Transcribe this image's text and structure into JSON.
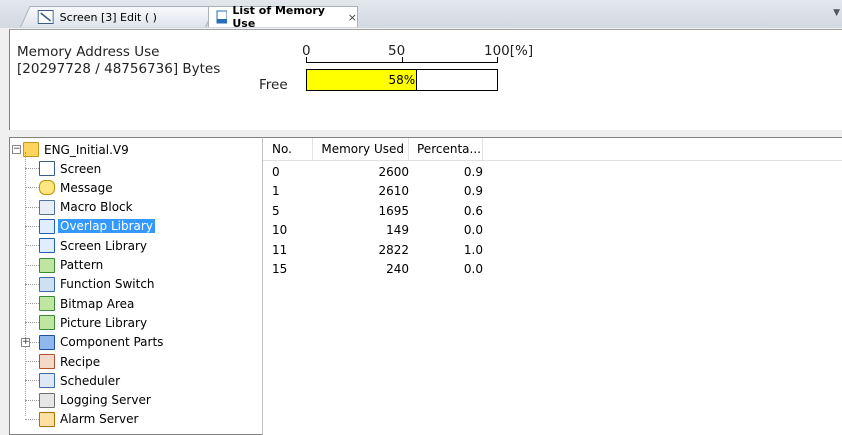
{
  "tabs": [
    {
      "label": "Screen [3] Edit (          )"
    },
    {
      "label": "List of Memory Use",
      "close": "×"
    }
  ],
  "memory": {
    "title": "Memory Address Use",
    "bytes": "[20297728 / 48756736] Bytes",
    "free_label": "Free",
    "scale": {
      "zero": "0",
      "mid": "50",
      "max": "100[%]"
    },
    "bar_percent_text": "58%",
    "bar_fill_fraction": 0.58,
    "bar_color": "#ffff00"
  },
  "tree": {
    "root": "ENG_Initial.V9",
    "items": [
      {
        "label": "Screen",
        "icon": "screen-icon"
      },
      {
        "label": "Message",
        "icon": "message-icon"
      },
      {
        "label": "Macro Block",
        "icon": "macro-block-icon"
      },
      {
        "label": "Overlap Library",
        "icon": "overlap-library-icon",
        "selected": true
      },
      {
        "label": "Screen Library",
        "icon": "screen-library-icon"
      },
      {
        "label": "Pattern",
        "icon": "pattern-icon"
      },
      {
        "label": "Function Switch",
        "icon": "function-switch-icon"
      },
      {
        "label": "Bitmap Area",
        "icon": "bitmap-area-icon"
      },
      {
        "label": "Picture Library",
        "icon": "picture-library-icon"
      },
      {
        "label": "Component Parts",
        "icon": "component-parts-icon",
        "expandable": true
      },
      {
        "label": "Recipe",
        "icon": "recipe-icon"
      },
      {
        "label": "Scheduler",
        "icon": "scheduler-icon"
      },
      {
        "label": "Logging Server",
        "icon": "logging-server-icon"
      },
      {
        "label": "Alarm Server",
        "icon": "alarm-server-icon"
      }
    ]
  },
  "list": {
    "columns": [
      "No.",
      "Memory Used",
      "Percenta..."
    ],
    "rows": [
      [
        "0",
        "2600",
        "0.9"
      ],
      [
        "1",
        "2610",
        "0.9"
      ],
      [
        "5",
        "1695",
        "0.6"
      ],
      [
        "10",
        "149",
        "0.0"
      ],
      [
        "11",
        "2822",
        "1.0"
      ],
      [
        "15",
        "240",
        "0.0"
      ]
    ]
  },
  "colors": {
    "selection": "#3399ff",
    "bar_fill": "#ffff00"
  }
}
